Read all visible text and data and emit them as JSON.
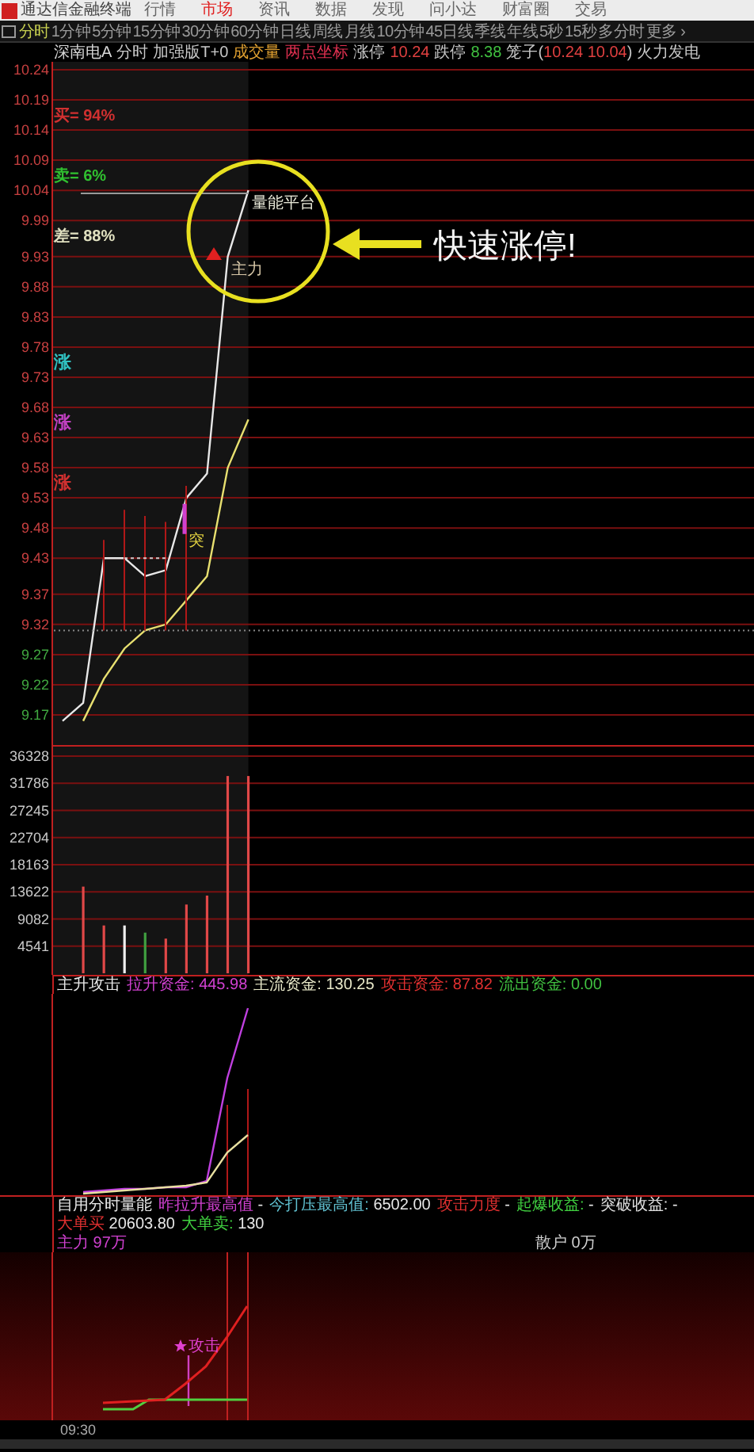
{
  "title_bar": {
    "app_name": "通达信金融终端",
    "menus": [
      {
        "label": "行情",
        "selected": false
      },
      {
        "label": "市场",
        "selected": true
      },
      {
        "label": "资讯",
        "selected": false
      },
      {
        "label": "数据",
        "selected": false
      },
      {
        "label": "发现",
        "selected": false
      },
      {
        "label": "问小达",
        "selected": false
      },
      {
        "label": "财富圈",
        "selected": false
      },
      {
        "label": "交易",
        "selected": false
      }
    ]
  },
  "period_bar": {
    "items": [
      {
        "label": "分时",
        "selected": true
      },
      {
        "label": "1分钟",
        "selected": false
      },
      {
        "label": "5分钟",
        "selected": false
      },
      {
        "label": "15分钟",
        "selected": false
      },
      {
        "label": "30分钟",
        "selected": false
      },
      {
        "label": "60分钟",
        "selected": false
      },
      {
        "label": "日线",
        "selected": false
      },
      {
        "label": "周线",
        "selected": false
      },
      {
        "label": "月线",
        "selected": false
      },
      {
        "label": "10分钟",
        "selected": false
      },
      {
        "label": "45日线",
        "selected": false
      },
      {
        "label": "季线",
        "selected": false
      },
      {
        "label": "年线",
        "selected": false
      },
      {
        "label": "5秒",
        "selected": false
      },
      {
        "label": "15秒",
        "selected": false
      },
      {
        "label": "多分时",
        "selected": false
      },
      {
        "label": "更多 ›",
        "selected": false
      }
    ]
  },
  "quote_info": {
    "segments": [
      {
        "parts": [
          {
            "text": "深南电A",
            "color": "#d8d8d8"
          }
        ]
      },
      {
        "parts": [
          {
            "text": "分时",
            "color": "#c8c8c8"
          }
        ]
      },
      {
        "parts": [
          {
            "text": "加强版T+0",
            "color": "#c8c8c8"
          }
        ]
      },
      {
        "parts": [
          {
            "text": "成交量",
            "color": "#e0a030"
          }
        ]
      },
      {
        "parts": [
          {
            "text": "两点坐标",
            "color": "#e03050"
          }
        ]
      },
      {
        "parts": [
          {
            "text": "涨停",
            "color": "#c8c8c8"
          }
        ]
      },
      {
        "parts": [
          {
            "text": "10.24",
            "color": "#e04040"
          }
        ]
      },
      {
        "parts": [
          {
            "text": "跌停",
            "color": "#c8c8c8"
          }
        ]
      },
      {
        "parts": [
          {
            "text": "8.38",
            "color": "#40c040"
          }
        ]
      },
      {
        "parts": [
          {
            "text": "笼子(",
            "color": "#c8c8c8"
          },
          {
            "text": "10.24 10.04",
            "color": "#e04040"
          },
          {
            "text": ")",
            "color": "#c8c8c8"
          }
        ]
      },
      {
        "parts": [
          {
            "text": "火力发电",
            "color": "#c8c8c8"
          }
        ]
      }
    ]
  },
  "price_panel": {
    "stats": [
      {
        "text": "买= 94%",
        "color": "#d03030"
      },
      {
        "text": "卖= 6%",
        "color": "#30c030"
      },
      {
        "text": "差= 88%",
        "color": "#e0e0c0"
      }
    ],
    "markers": [
      {
        "text": "涨",
        "color": "#30c0c0"
      },
      {
        "text": "涨",
        "color": "#c040c0"
      },
      {
        "text": "涨",
        "color": "#d03030"
      }
    ],
    "platform_label": "量能平台",
    "main_force_label": "主力",
    "breakout_label": "突",
    "callout": "快速涨停!",
    "chart_data": {
      "type": "line",
      "grid": true,
      "categories": [
        null,
        null,
        null,
        null,
        null,
        null,
        null,
        null,
        null,
        null,
        null,
        null,
        null,
        null,
        null,
        null,
        null,
        null,
        null,
        null,
        null,
        null,
        null,
        null,
        null,
        null,
        null,
        null,
        null,
        null,
        null,
        null,
        null,
        null
      ],
      "ylim": [
        9.12,
        10.24
      ],
      "yticks": [
        10.24,
        10.19,
        10.14,
        10.09,
        10.04,
        9.99,
        9.93,
        9.88,
        9.83,
        9.78,
        9.73,
        9.68,
        9.63,
        9.58,
        9.53,
        9.48,
        9.43,
        9.37,
        9.32,
        9.27,
        9.22,
        9.17
      ],
      "series": [
        {
          "color": "#e8e8e8",
          "values": [
            9.16,
            9.19,
            9.43,
            9.43,
            9.4,
            9.41,
            9.53,
            9.57,
            9.93,
            10.04,
            null,
            null,
            null,
            null,
            null,
            null,
            null,
            null,
            null,
            null,
            null,
            null,
            null,
            null,
            null,
            null,
            null,
            null,
            null,
            null,
            null,
            null,
            null,
            null
          ]
        },
        {
          "color": "#e8e070",
          "values": [
            null,
            9.16,
            9.23,
            9.28,
            9.31,
            9.32,
            9.36,
            9.4,
            9.58,
            9.66,
            null,
            null,
            null,
            null,
            null,
            null,
            null,
            null,
            null,
            null,
            null,
            null,
            null,
            null,
            null,
            null,
            null,
            null,
            null,
            null,
            null,
            null,
            null,
            null
          ]
        }
      ]
    }
  },
  "volume_panel": {
    "chart_data": {
      "type": "bar",
      "grid": true,
      "categories": [
        null,
        null,
        null,
        null,
        null,
        null,
        null,
        null,
        null,
        null,
        null,
        null,
        null,
        null,
        null,
        null,
        null,
        null,
        null,
        null,
        null,
        null,
        null,
        null,
        null,
        null,
        null,
        null,
        null,
        null,
        null,
        null,
        null,
        null
      ],
      "ylim": [
        0,
        36328
      ],
      "yticks": [
        36328,
        31786,
        27245,
        22704,
        18163,
        13622,
        9082,
        4541
      ],
      "series": [
        {
          "color": "#e04848",
          "values": [
            null,
            14500,
            8000,
            null,
            null,
            5800,
            11500,
            13000,
            33000,
            33000,
            null,
            null,
            null,
            null,
            null,
            null,
            null,
            null,
            null,
            null,
            null,
            null,
            null,
            null,
            null,
            null,
            null,
            null,
            null,
            null,
            null,
            null,
            null,
            null
          ]
        },
        {
          "color": "#f0f0f0",
          "values": [
            null,
            null,
            null,
            8000,
            null,
            null,
            null,
            null,
            null,
            null,
            null,
            null,
            null,
            null,
            null,
            null,
            null,
            null,
            null,
            null,
            null,
            null,
            null,
            null,
            null,
            null,
            null,
            null,
            null,
            null,
            null,
            null,
            null,
            null
          ]
        },
        {
          "color": "#40a040",
          "values": [
            null,
            null,
            null,
            null,
            6800,
            null,
            null,
            null,
            null,
            null,
            null,
            null,
            null,
            null,
            null,
            null,
            null,
            null,
            null,
            null,
            null,
            null,
            null,
            null,
            null,
            null,
            null,
            null,
            null,
            null,
            null,
            null,
            null,
            null
          ]
        }
      ]
    }
  },
  "fund_row": {
    "title": "主升攻击",
    "items": [
      {
        "label": "拉升资金:",
        "value": "445.98",
        "color": "#d040d0"
      },
      {
        "label": "主流资金:",
        "value": "130.25",
        "color": "#e8e8c8"
      },
      {
        "label": "攻击资金:",
        "value": "87.82",
        "color": "#e03030"
      },
      {
        "label": "流出资金:",
        "value": "0.00",
        "color": "#40c040"
      }
    ]
  },
  "volume_energy": {
    "title": "自用分时量能",
    "items": [
      {
        "label": "昨拉升最高值",
        "value": "-",
        "color": "#d040d0"
      },
      {
        "label": "今打压最高值:",
        "value": "6502.00",
        "color": "#60c0d0"
      },
      {
        "label": "攻击力度",
        "value": "-",
        "color": "#e03030"
      },
      {
        "label": "起爆收益:",
        "value": "-",
        "color": "#40d040"
      },
      {
        "label": "突破收益:",
        "value": "-",
        "color": "#e0e0e0"
      },
      {
        "label": "大单买",
        "value": "20603.80",
        "color": "#e03030"
      },
      {
        "label": "大单卖:",
        "value": "130",
        "color": "#40d040"
      }
    ],
    "main_force": "主力 97万",
    "retail": "散户 0万"
  },
  "bottom_panel": {
    "attack_label": "攻击"
  },
  "time_axis": {
    "start": "09:30"
  }
}
